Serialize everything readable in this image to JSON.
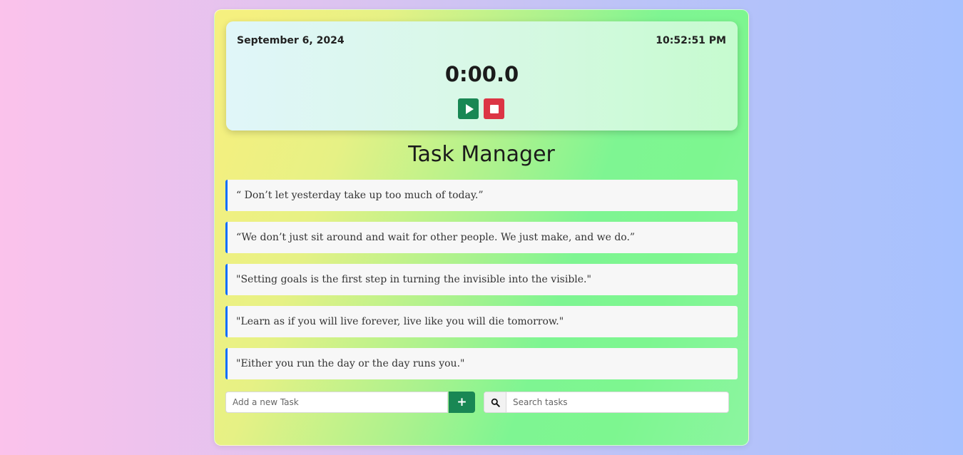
{
  "timer": {
    "date": "September 6, 2024",
    "time": "10:52:51 PM",
    "stopwatch": "0:00.0"
  },
  "title": "Task Manager",
  "quotes": [
    "“ Don’t let yesterday take up too much of today.”",
    "“We don’t just sit around and wait for other people. We just make, and we do.”",
    "\"Setting goals is the first step in turning the invisible into the visible.\"",
    "\"Learn as if you will live forever, live like you will die tomorrow.\"",
    "\"Either you run the day or the day runs you.\""
  ],
  "add_task": {
    "placeholder": "Add a new Task",
    "button": "+"
  },
  "search": {
    "placeholder": "Search tasks",
    "icon": "search-icon"
  },
  "colors": {
    "play": "#198754",
    "stop": "#dc3545",
    "add": "#198754",
    "quote_accent": "#0d6efd"
  }
}
